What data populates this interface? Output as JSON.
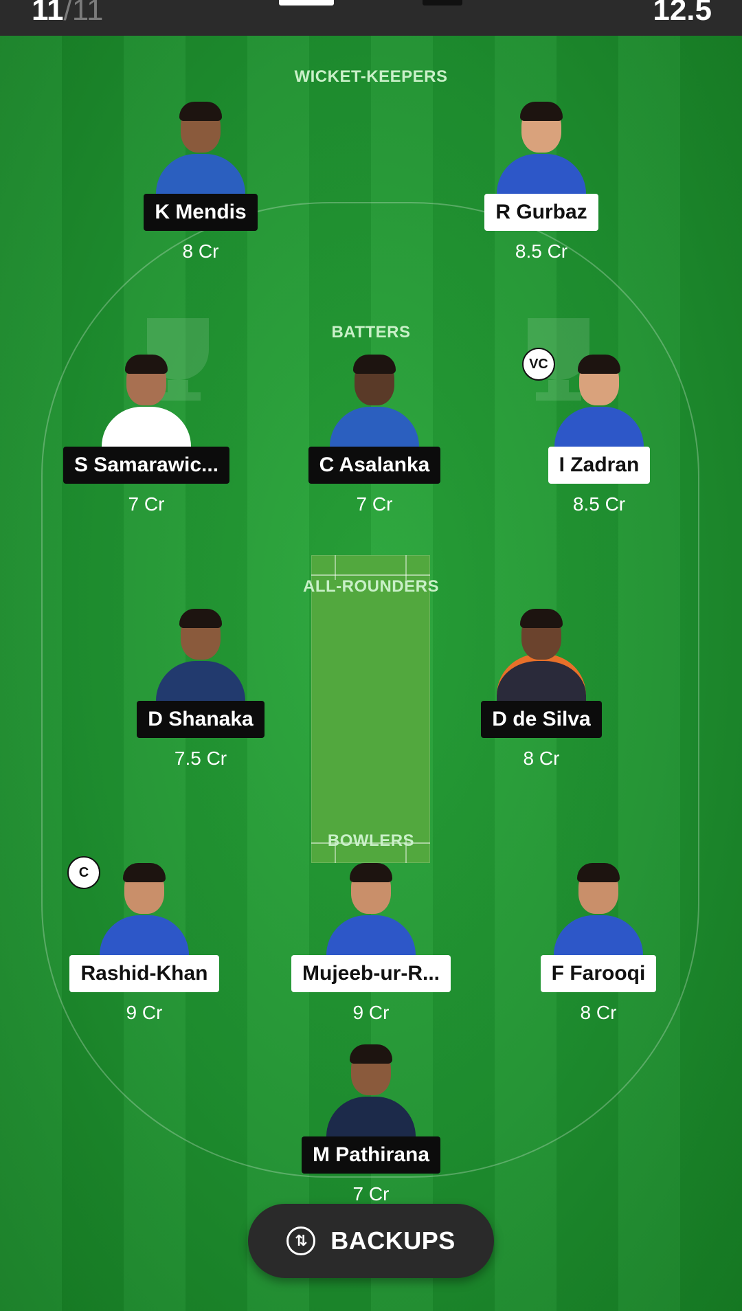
{
  "header": {
    "players_selected": "11",
    "players_total": "/11",
    "credits_left": "12.5"
  },
  "sections": {
    "wicket_keepers": "WICKET-KEEPERS",
    "batters": "BATTERS",
    "all_rounders": "ALL-ROUNDERS",
    "bowlers": "BOWLERS"
  },
  "players": [
    {
      "name": "K Mendis",
      "credits": "8 Cr",
      "badge": "dark",
      "kit": "#2b5fbf"
    },
    {
      "name": "R Gurbaz",
      "credits": "8.5 Cr",
      "badge": "light",
      "kit": "#2d57c8"
    },
    {
      "name": "S Samarawic...",
      "credits": "7 Cr",
      "badge": "dark",
      "kit": "#ffffff"
    },
    {
      "name": "C Asalanka",
      "credits": "7 Cr",
      "badge": "dark",
      "kit": "#2b5fbf"
    },
    {
      "name": "I Zadran",
      "credits": "8.5 Cr",
      "badge": "light",
      "kit": "#2d57c8"
    },
    {
      "name": "D Shanaka",
      "credits": "7.5 Cr",
      "badge": "dark",
      "kit": "#223a6e"
    },
    {
      "name": "D de Silva",
      "credits": "8 Cr",
      "badge": "dark",
      "kit": "#2a2a3a"
    },
    {
      "name": "Rashid-Khan",
      "credits": "9 Cr",
      "badge": "light",
      "kit": "#2d57c8"
    },
    {
      "name": "Mujeeb-ur-R...",
      "credits": "9 Cr",
      "badge": "light",
      "kit": "#2d57c8"
    },
    {
      "name": "F Farooqi",
      "credits": "8 Cr",
      "badge": "light",
      "kit": "#2d57c8"
    },
    {
      "name": "M Pathirana",
      "credits": "7 Cr",
      "badge": "dark",
      "kit": "#1c2a4a"
    }
  ],
  "roles": {
    "captain": "C",
    "vice_captain": "VC"
  },
  "backups": {
    "label": "BACKUPS",
    "icon": "swap-arrows-icon"
  },
  "colors": {
    "field": "#1d8a2a",
    "topbar": "#2b2b2b",
    "section_label": "#c9f0c8"
  }
}
